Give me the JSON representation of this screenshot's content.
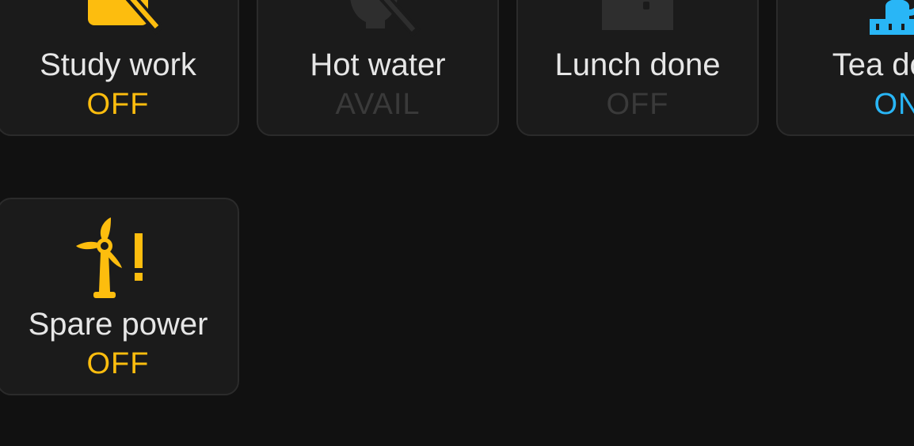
{
  "tiles": [
    {
      "id": "study",
      "label": "Study work",
      "state": "OFF",
      "icon": "study-off-icon",
      "accent": "#fdbd0e"
    },
    {
      "id": "hot",
      "label": "Hot water",
      "state": "AVAIL",
      "icon": "kettle-off-icon",
      "accent": "#3a3a3a"
    },
    {
      "id": "lunch",
      "label": "Lunch done",
      "state": "OFF",
      "icon": "lunchbox-icon",
      "accent": "#3a3a3a"
    },
    {
      "id": "tea",
      "label": "Tea done",
      "state": "ON",
      "icon": "tea-icon",
      "accent": "#29b6f6"
    },
    {
      "id": "spare",
      "label": "Spare power",
      "state": "OFF",
      "icon": "wind-turbine-alert-icon",
      "accent": "#fdbd0e"
    }
  ],
  "colors": {
    "background": "#111111",
    "tile_background": "#1b1b1b",
    "tile_border": "#2b2b2b",
    "label_text": "#e6e6e6",
    "off_yellow": "#fdbd0e",
    "on_blue": "#29b6f6",
    "dimmed": "#3a3a3a"
  }
}
